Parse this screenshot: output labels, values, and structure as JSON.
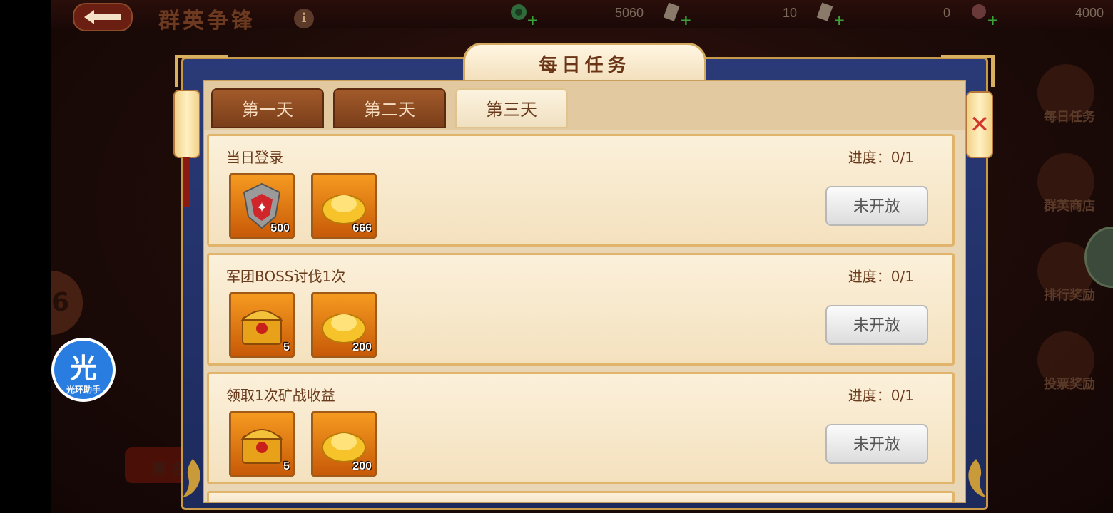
{
  "topbar": {
    "title": "群英争锋",
    "info": "i",
    "resources": [
      {
        "icon": "green-gear-icon",
        "value": "5060"
      },
      {
        "icon": "scroll-icon",
        "value": "10"
      },
      {
        "icon": "scroll-icon",
        "value": "0"
      },
      {
        "icon": "horse-icon",
        "value": "4000"
      }
    ]
  },
  "side_menu": [
    "每日任务",
    "群英商店",
    "排行奖励",
    "投票奖励"
  ],
  "left_panel": {
    "number": "6",
    "button": "善 名"
  },
  "assistant": {
    "glyph": "光",
    "caption": "光环助手"
  },
  "dialog": {
    "title": "每日任务",
    "close": "✕",
    "tabs": [
      "第一天",
      "第二天",
      "第三天"
    ],
    "active_tab": 2,
    "tasks": [
      {
        "name": "当日登录",
        "progress": "进度：0/1",
        "button": "未开放",
        "rewards": [
          {
            "icon": "shield-helmet-icon",
            "count": "500"
          },
          {
            "icon": "gold-ingot-icon",
            "count": "666"
          }
        ]
      },
      {
        "name": "军团BOSS讨伐1次",
        "progress": "进度：0/1",
        "button": "未开放",
        "rewards": [
          {
            "icon": "treasure-chest-icon",
            "count": "5"
          },
          {
            "icon": "gold-ingot-icon",
            "count": "200"
          }
        ]
      },
      {
        "name": "领取1次矿战收益",
        "progress": "进度：0/1",
        "button": "未开放",
        "rewards": [
          {
            "icon": "treasure-chest-icon",
            "count": "5"
          },
          {
            "icon": "gold-ingot-icon",
            "count": "200"
          }
        ]
      }
    ]
  },
  "colors": {
    "frame": "#1c2a5c",
    "parchment": "#f4e1be",
    "tab_inactive": "#7a3e1a",
    "reward_bg": "#e88a18"
  }
}
